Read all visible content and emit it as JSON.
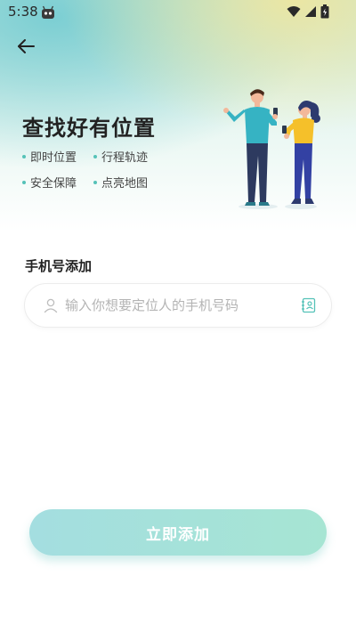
{
  "status_bar": {
    "time": "5:38",
    "icons": [
      "robot-icon",
      "wifi-icon",
      "signal-icon",
      "battery-icon"
    ]
  },
  "header": {
    "back_icon": "arrow-left-icon",
    "title": "查找好有位置"
  },
  "features": [
    {
      "label": "即时位置"
    },
    {
      "label": "行程轨迹"
    },
    {
      "label": "安全保障"
    },
    {
      "label": "点亮地图"
    }
  ],
  "form": {
    "section_label": "手机号添加",
    "phone_input": {
      "value": "",
      "placeholder": "输入你想要定位人的手机号码"
    },
    "contacts_icon": "contacts-book-icon"
  },
  "submit": {
    "label": "立即添加"
  },
  "colors": {
    "accent": "#55c2b8",
    "button_start": "#a4dee0",
    "button_end": "#a6e5d3",
    "title": "#222222"
  }
}
